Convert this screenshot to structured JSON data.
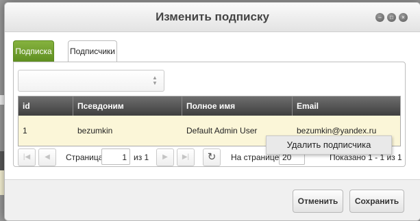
{
  "dialog": {
    "title": "Изменить подписку",
    "window_buttons": [
      "minimize-icon",
      "maximize-icon",
      "close-icon"
    ]
  },
  "tabs": [
    {
      "label": "Подписка",
      "active": false,
      "color": "#6e9e2a"
    },
    {
      "label": "Подписчики",
      "active": true
    }
  ],
  "filter_select": {
    "value": ""
  },
  "grid": {
    "columns": [
      "id",
      "Псевдоним",
      "Полное имя",
      "Email"
    ],
    "rows": [
      {
        "id": "1",
        "nickname": "bezumkin",
        "full_name": "Default Admin User",
        "email": "bezumkin@yandex.ru"
      }
    ]
  },
  "pager": {
    "page_label": "Страница",
    "page_value": "1",
    "of_label": "из 1",
    "per_page_label": "На странице:",
    "per_page_value": "20",
    "shown_label": "Показано 1 - 1 из 1"
  },
  "context_menu": {
    "item": "Удалить подписчика"
  },
  "footer": {
    "cancel_label": "Отменить",
    "save_label": "Сохранить"
  }
}
